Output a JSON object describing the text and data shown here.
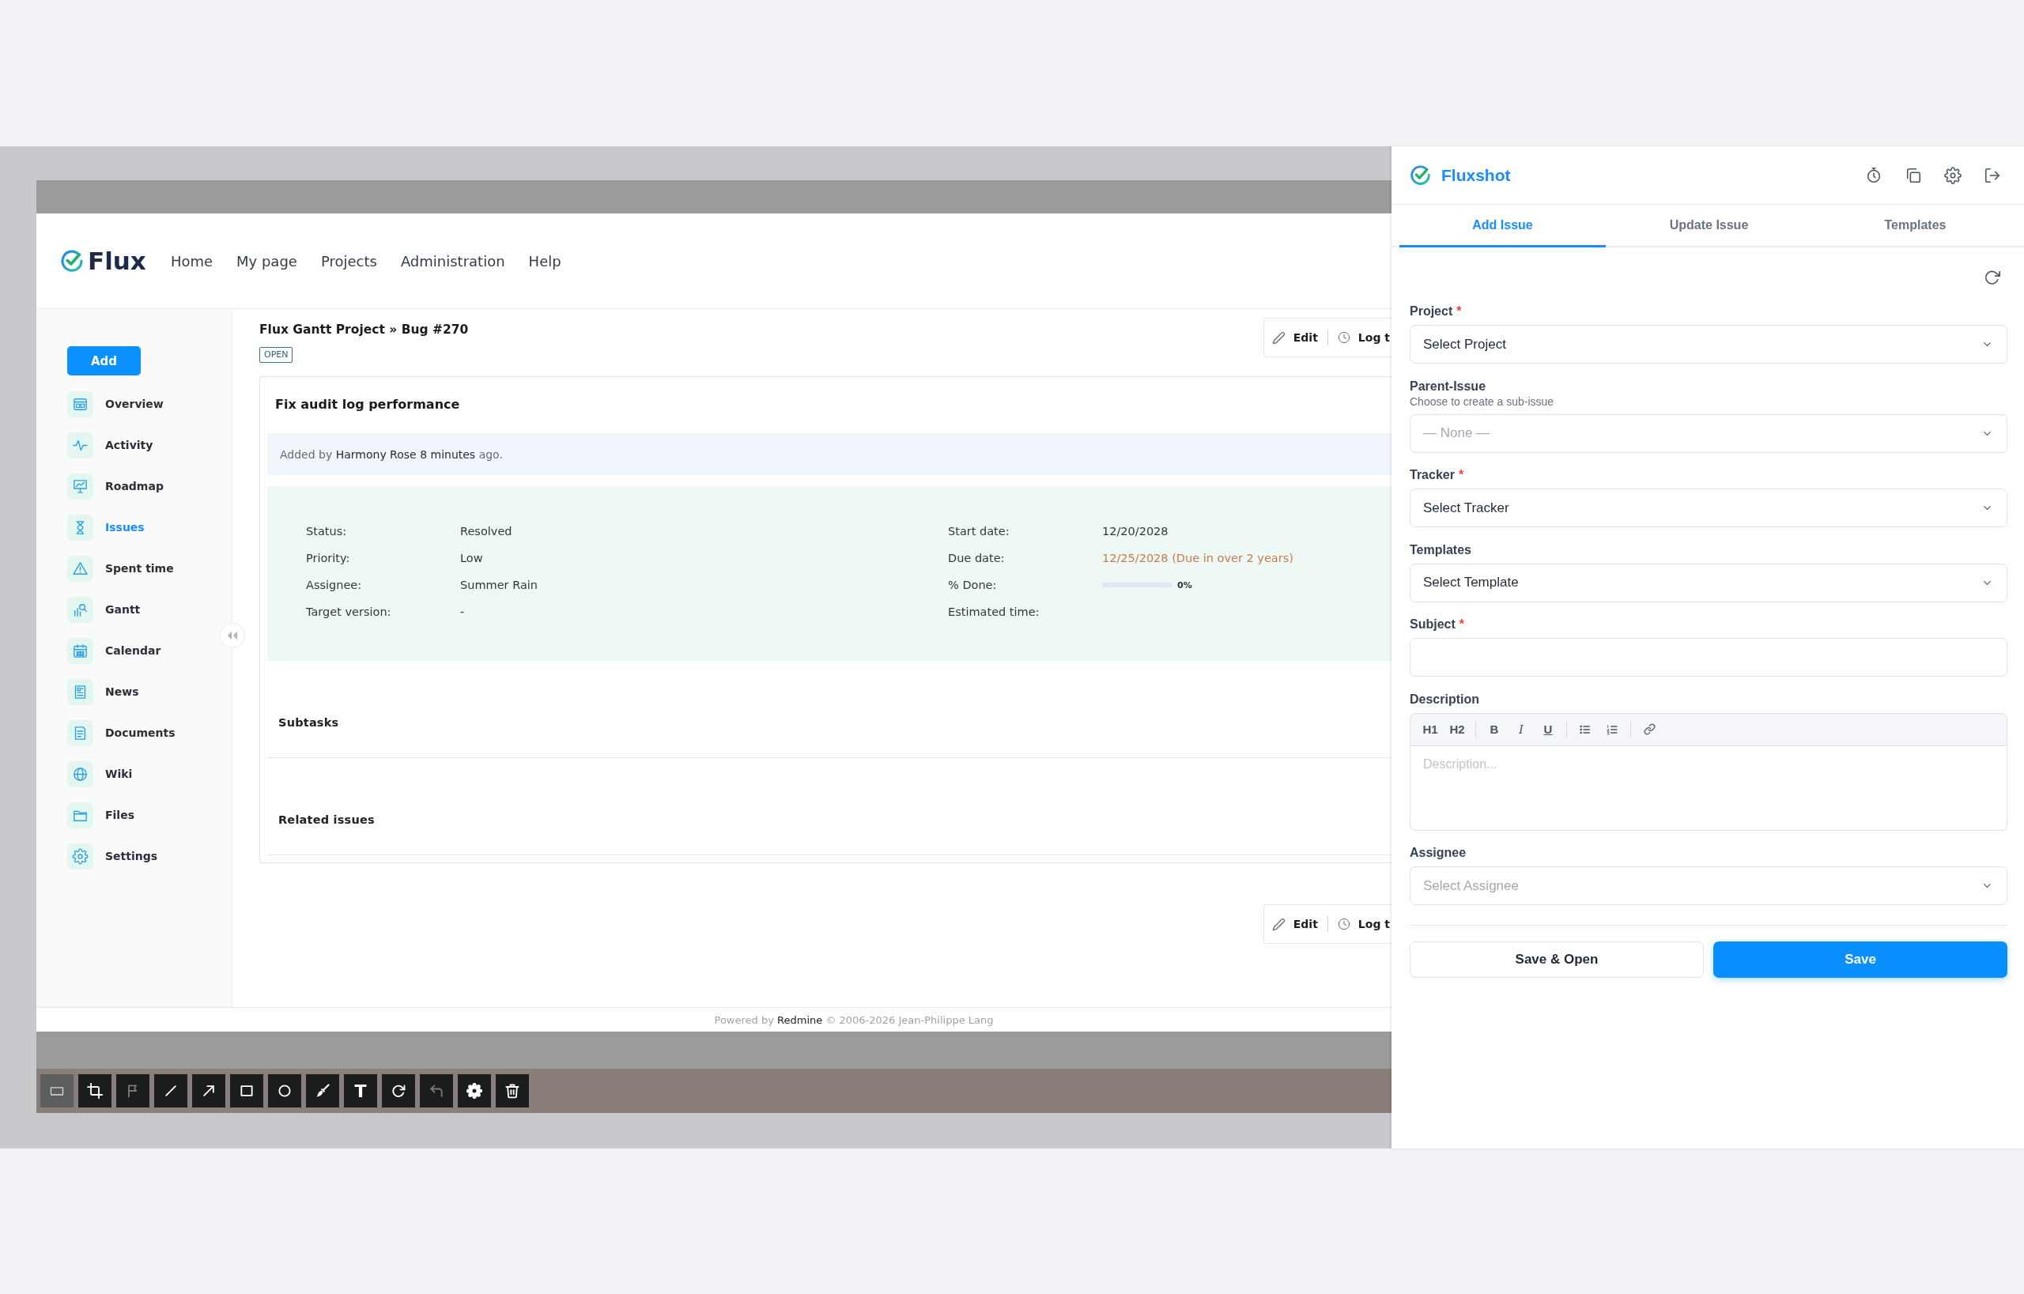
{
  "capture": {
    "header": {
      "logo": "Flux",
      "nav": [
        "Home",
        "My page",
        "Projects",
        "Administration",
        "Help"
      ]
    },
    "sidebar": {
      "add_button": "Add",
      "items": [
        {
          "label": "Overview",
          "selected": false
        },
        {
          "label": "Activity",
          "selected": false
        },
        {
          "label": "Roadmap",
          "selected": false
        },
        {
          "label": "Issues",
          "selected": true
        },
        {
          "label": "Spent time",
          "selected": false
        },
        {
          "label": "Gantt",
          "selected": false
        },
        {
          "label": "Calendar",
          "selected": false
        },
        {
          "label": "News",
          "selected": false
        },
        {
          "label": "Documents",
          "selected": false
        },
        {
          "label": "Wiki",
          "selected": false
        },
        {
          "label": "Files",
          "selected": false
        },
        {
          "label": "Settings",
          "selected": false
        }
      ]
    },
    "issue": {
      "breadcrumb": "Flux Gantt Project » Bug #270",
      "status_badge": "OPEN",
      "actions": [
        {
          "kind": "edit",
          "label": "Edit"
        },
        {
          "kind": "log",
          "label": "Log t"
        }
      ],
      "subject": "Fix audit log performance",
      "added_by": {
        "prefix": "Added by",
        "author": "Harmony Rose",
        "age": "8 minutes",
        "suffix": "ago."
      },
      "attributes_left": [
        {
          "label": "Status:",
          "value": "Resolved"
        },
        {
          "label": "Priority:",
          "value": "Low"
        },
        {
          "label": "Assignee:",
          "value": "Summer Rain"
        },
        {
          "label": "Target version:",
          "value": "-"
        }
      ],
      "attributes_right": [
        {
          "kind": "text",
          "label": "Start date:",
          "value": "12/20/2028"
        },
        {
          "kind": "due",
          "label": "Due date:",
          "value": "12/25/2028 (Due in over 2 years)"
        },
        {
          "kind": "progress",
          "label": "% Done:",
          "level": 0,
          "reading": "0%"
        },
        {
          "kind": "text",
          "label": "Estimated time:"
        }
      ],
      "sections": [
        {
          "title": "Subtasks"
        },
        {
          "title": "Related issues"
        }
      ],
      "actions_bottom": [
        {
          "kind": "edit",
          "label": "Edit"
        },
        {
          "kind": "log",
          "label": "Log t"
        }
      ]
    },
    "footer": {
      "prefix": "Powered by",
      "link": "Redmine",
      "suffix": "© 2006-2026 Jean-Philippe Lang"
    },
    "toolbar": [
      {
        "kind": "select",
        "selected": true,
        "disabled": false
      },
      {
        "kind": "crop",
        "selected": false,
        "disabled": false
      },
      {
        "kind": "flag",
        "selected": false,
        "disabled": true
      },
      {
        "kind": "line",
        "selected": false,
        "disabled": false
      },
      {
        "kind": "arrow",
        "selected": false,
        "disabled": false
      },
      {
        "kind": "rectangle",
        "selected": false,
        "disabled": false
      },
      {
        "kind": "ellipse",
        "selected": false,
        "disabled": false
      },
      {
        "kind": "brush",
        "selected": false,
        "disabled": false
      },
      {
        "kind": "text",
        "glyph": "T",
        "selected": false,
        "disabled": false
      },
      {
        "kind": "redo",
        "selected": false,
        "disabled": false
      },
      {
        "kind": "undo",
        "selected": false,
        "disabled": true
      },
      {
        "kind": "settings",
        "selected": false,
        "disabled": false
      },
      {
        "kind": "delete",
        "selected": false,
        "disabled": false
      }
    ]
  },
  "panel": {
    "title": "Fluxshot",
    "tabs": [
      {
        "label": "Add Issue",
        "selected": true
      },
      {
        "label": "Update Issue",
        "selected": false
      },
      {
        "label": "Templates",
        "selected": false
      }
    ],
    "fields": [
      {
        "kind": "select",
        "label": "Project",
        "required_mark": "*",
        "value": "Select Project"
      },
      {
        "kind": "select",
        "label": "Parent-Issue",
        "hint": "Choose to create a sub-issue",
        "placeholder": "— None —"
      },
      {
        "kind": "select",
        "label": "Tracker",
        "required_mark": "*",
        "value": "Select Tracker"
      },
      {
        "kind": "select",
        "label": "Templates",
        "value": "Select Template"
      },
      {
        "kind": "text",
        "label": "Subject",
        "required_mark": "*"
      },
      {
        "kind": "editor",
        "label": "Description",
        "headings": [
          "H1",
          "H2"
        ],
        "marks": [
          {
            "kind": "bold",
            "label": "B"
          },
          {
            "kind": "italic",
            "label": "I"
          },
          {
            "kind": "underline",
            "label": "U"
          }
        ],
        "placeholder": "Description..."
      },
      {
        "kind": "select",
        "label": "Assignee",
        "placeholder": "Select Assignee"
      }
    ],
    "buttons": [
      {
        "kind": "secondary",
        "label": "Save & Open"
      },
      {
        "kind": "primary",
        "label": "Save"
      }
    ]
  }
}
